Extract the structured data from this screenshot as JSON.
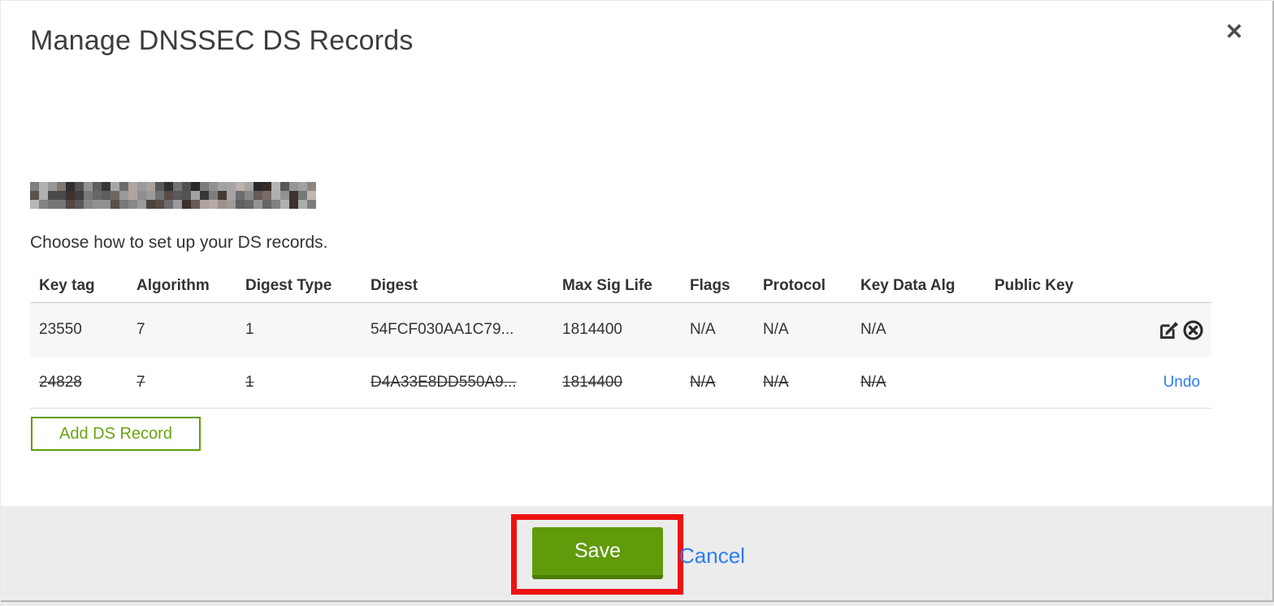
{
  "modal": {
    "title": "Manage DNSSEC DS Records",
    "close_icon": "✕",
    "intro": "Choose how to set up your DS records.",
    "domain_redacted": true
  },
  "table": {
    "columns": [
      "Key tag",
      "Algorithm",
      "Digest Type",
      "Digest",
      "Max Sig Life",
      "Flags",
      "Protocol",
      "Key Data Alg",
      "Public Key"
    ],
    "rows": [
      {
        "key_tag": "23550",
        "algorithm": "7",
        "digest_type": "1",
        "digest": "54FCF030AA1C79...",
        "max_sig_life": "1814400",
        "flags": "N/A",
        "protocol": "N/A",
        "key_data_alg": "N/A",
        "public_key": "",
        "state": "normal"
      },
      {
        "key_tag": "24828",
        "algorithm": "7",
        "digest_type": "1",
        "digest": "D4A33E8DD550A9...",
        "max_sig_life": "1814400",
        "flags": "N/A",
        "protocol": "N/A",
        "key_data_alg": "N/A",
        "public_key": "",
        "state": "deleted",
        "undo_label": "Undo"
      }
    ],
    "add_button_label": "Add DS Record"
  },
  "footer": {
    "save_label": "Save",
    "cancel_label": "Cancel"
  },
  "colors": {
    "button_green": "#619b0c",
    "button_green_dark": "#4c7c05",
    "outline_green": "#5f9c0a",
    "link_blue": "#2e7cf0",
    "annotation_red": "#ee1212",
    "footer_bg": "#ececec",
    "row_stripe_bg": "#f7f7f7"
  }
}
